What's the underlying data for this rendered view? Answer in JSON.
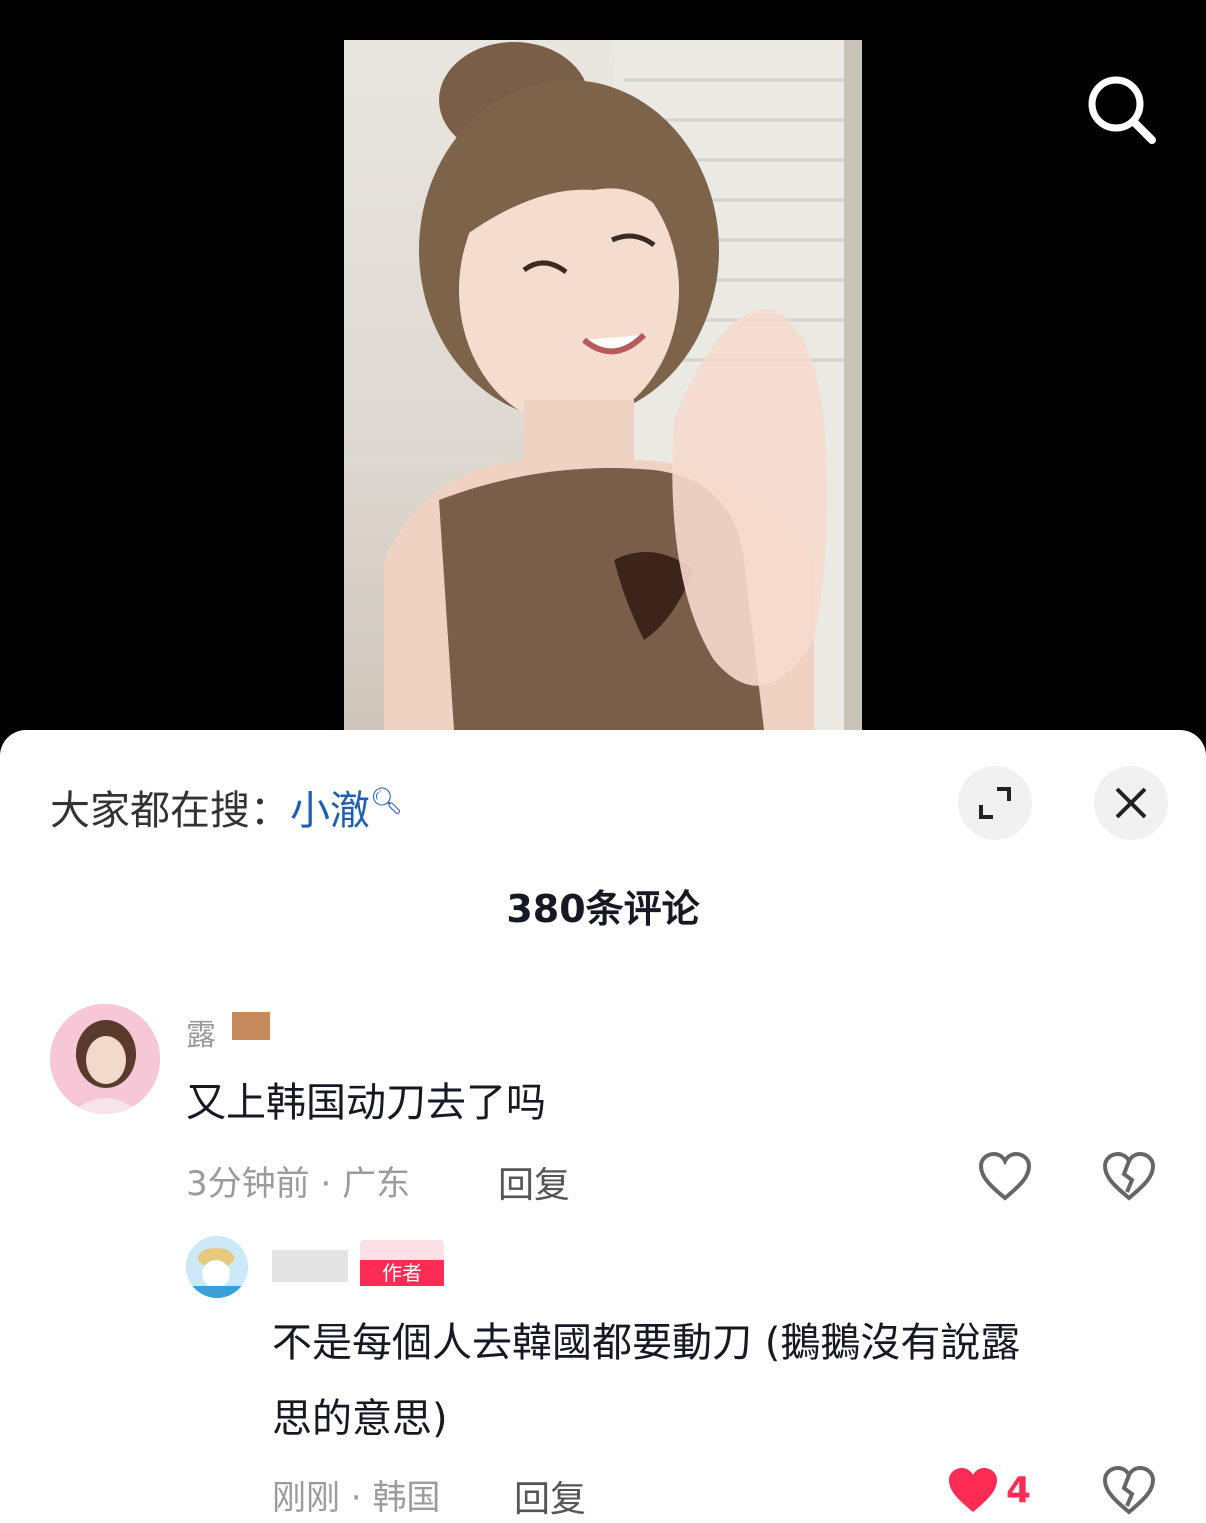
{
  "trending": {
    "prefix": "大家都在搜：",
    "keyword": "小澈"
  },
  "comments_count": "380条评论",
  "comments": [
    {
      "username": "露",
      "text": "又上韩国动刀去了吗",
      "time": "3分钟前",
      "location": "广东",
      "reply_label": "回复"
    }
  ],
  "reply": {
    "author_badge": "作者",
    "text_line1": "不是每個人去韓國都要動刀 (鵝鵝沒有說露",
    "text_line2": "思的意思)",
    "time": "刚刚",
    "location": "韩国",
    "reply_label": "回复",
    "like_count": "4"
  },
  "colors": {
    "keyword": "#1e5fb4",
    "like_active": "#fe2c55",
    "author_badge": "#fe2c55"
  }
}
